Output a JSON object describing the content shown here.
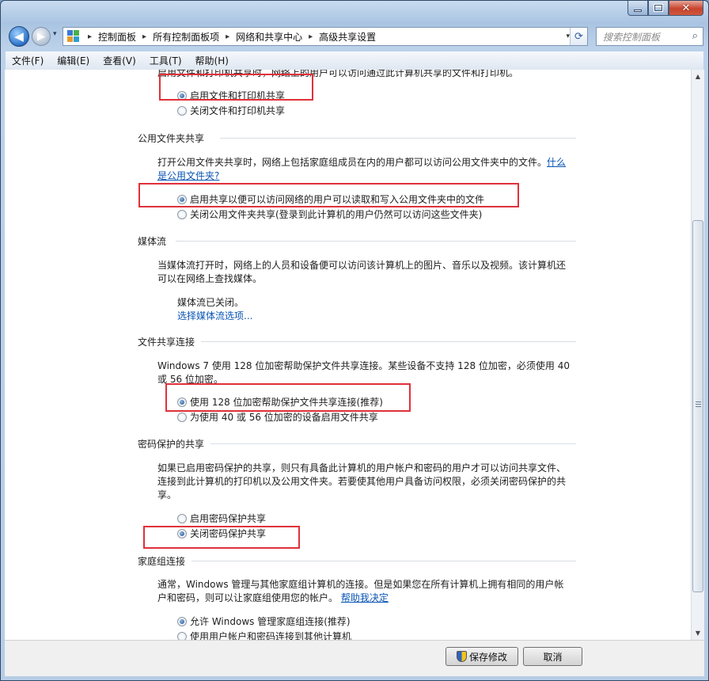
{
  "window": {
    "close_glyph": "✕"
  },
  "nav": {
    "back_glyph": "◀",
    "forward_glyph": "▶",
    "dropdown_glyph": "▾"
  },
  "address": {
    "crumbs": [
      "控制面板",
      "所有控制面板项",
      "网络和共享中心",
      "高级共享设置"
    ],
    "separator": "▸",
    "dropdown_glyph": "▾",
    "refresh_glyph": "⟳"
  },
  "search": {
    "placeholder": "搜索控制面板",
    "icon": "search-icon",
    "icon_glyph": "⌕"
  },
  "menu": {
    "items": [
      "文件(F)",
      "编辑(E)",
      "查看(V)",
      "工具(T)",
      "帮助(H)"
    ]
  },
  "sections": {
    "printer": {
      "desc_partial": "启用文件和打印机共享时，网络上的用户可以访问通过此计算机共享的文件和打印机。",
      "options": [
        "启用文件和打印机共享",
        "关闭文件和打印机共享"
      ],
      "selected": 0
    },
    "public_folder": {
      "heading": "公用文件夹共享",
      "desc": "打开公用文件夹共享时，网络上包括家庭组成员在内的用户都可以访问公用文件夹中的文件。",
      "link": "什么是公用文件夹?",
      "options": [
        "启用共享以便可以访问网络的用户可以读取和写入公用文件夹中的文件",
        "关闭公用文件夹共享(登录到此计算机的用户仍然可以访问这些文件夹)"
      ],
      "selected": 0
    },
    "media": {
      "heading": "媒体流",
      "desc": "当媒体流打开时，网络上的人员和设备便可以访问该计算机上的图片、音乐以及视频。该计算机还可以在网络上查找媒体。",
      "status": "媒体流已关闭。",
      "link": "选择媒体流选项..."
    },
    "file_sharing": {
      "heading": "文件共享连接",
      "desc": "Windows 7 使用 128 位加密帮助保护文件共享连接。某些设备不支持 128 位加密，必须使用 40 或 56 位加密。",
      "options": [
        "使用 128 位加密帮助保护文件共享连接(推荐)",
        "为使用 40 或 56 位加密的设备启用文件共享"
      ],
      "selected": 0
    },
    "password": {
      "heading": "密码保护的共享",
      "desc": "如果已启用密码保护的共享，则只有具备此计算机的用户帐户和密码的用户才可以访问共享文件、连接到此计算机的打印机以及公用文件夹。若要使其他用户具备访问权限，必须关闭密码保护的共享。",
      "options": [
        "启用密码保护共享",
        "关闭密码保护共享"
      ],
      "selected": 1
    },
    "homegroup": {
      "heading": "家庭组连接",
      "desc": "通常，Windows 管理与其他家庭组计算机的连接。但是如果您在所有计算机上拥有相同的用户帐户和密码，则可以让家庭组使用您的帐户。",
      "link": "帮助我决定",
      "options": [
        "允许 Windows 管理家庭组连接(推荐)",
        "使用用户帐户和密码连接到其他计算机"
      ],
      "selected": 0
    }
  },
  "footer": {
    "save_label": "保存修改",
    "cancel_label": "取消"
  },
  "colors": {
    "highlight": "#e0313a",
    "link": "#0a55b3"
  }
}
